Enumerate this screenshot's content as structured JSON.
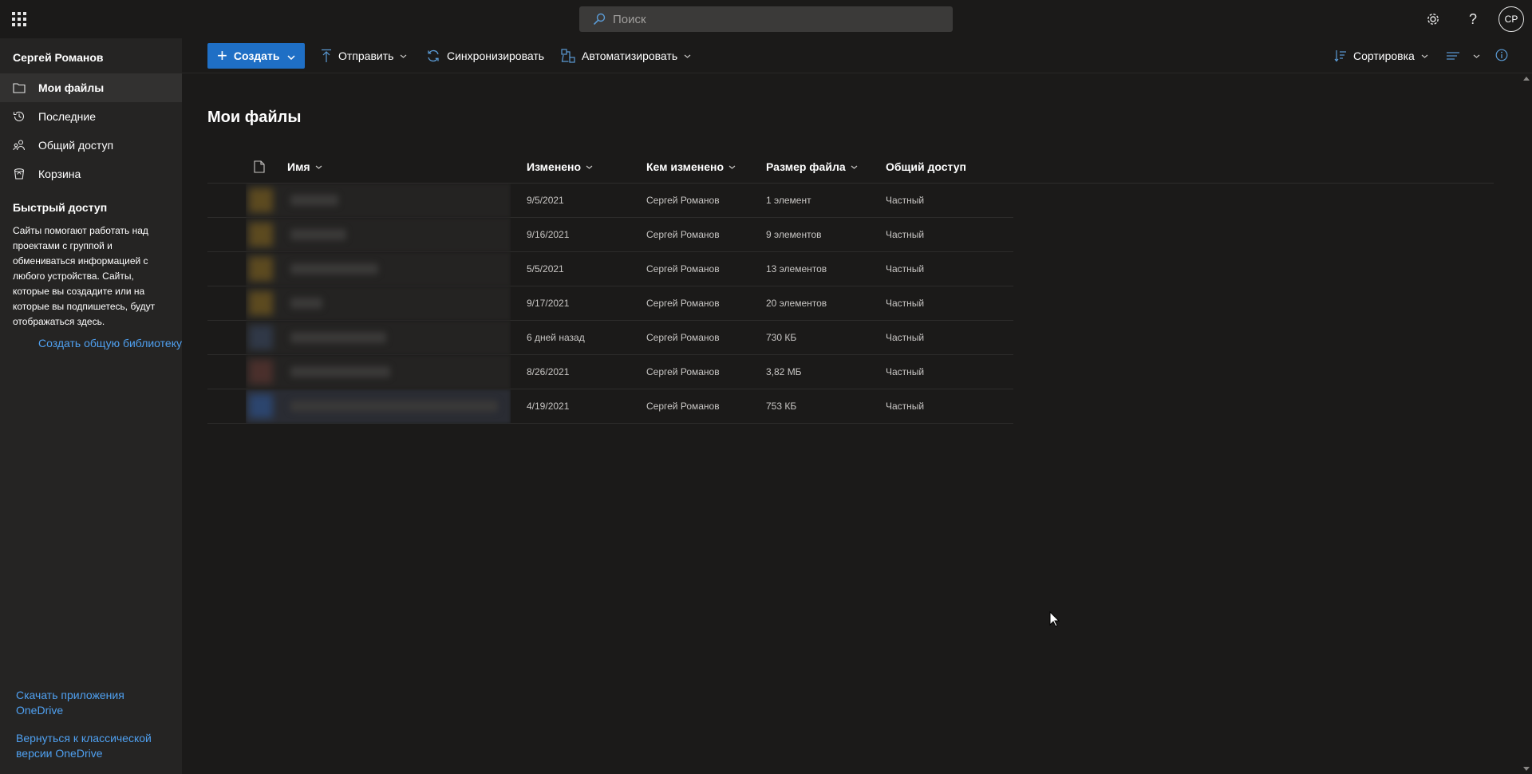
{
  "topbar": {
    "search_placeholder": "Поиск",
    "avatar_initials": "СР"
  },
  "nav": {
    "user_name": "Сергей Романов",
    "items": [
      {
        "label": "Мои файлы",
        "icon": "folder-icon",
        "active": true
      },
      {
        "label": "Последние",
        "icon": "history-icon",
        "active": false
      },
      {
        "label": "Общий доступ",
        "icon": "shared-people-icon",
        "active": false
      },
      {
        "label": "Корзина",
        "icon": "recycle-bin-icon",
        "active": false
      }
    ],
    "quick_access_title": "Быстрый доступ",
    "quick_access_desc": "Сайты помогают работать над проектами с группой и обмениваться информацией с любого устройства. Сайты, которые вы создадите или на которые вы подпишетесь, будут отображаться здесь.",
    "create_library_link": "Создать общую библиотеку",
    "download_apps_link": "Скачать приложения OneDrive",
    "classic_link": "Вернуться к классической версии OneDrive"
  },
  "cmdbar": {
    "create": "Создать",
    "upload": "Отправить",
    "sync": "Синхронизировать",
    "automate": "Автоматизировать",
    "sort": "Сортировка"
  },
  "main": {
    "title": "Мои файлы",
    "columns": {
      "name": "Имя",
      "modified": "Изменено",
      "modified_by": "Кем изменено",
      "size": "Размер файла",
      "sharing": "Общий доступ"
    },
    "rows": [
      {
        "modified": "9/5/2021",
        "modified_by": "Сергей Романов",
        "size": "1 элемент",
        "sharing": "Частный"
      },
      {
        "modified": "9/16/2021",
        "modified_by": "Сергей Романов",
        "size": "9 элементов",
        "sharing": "Частный"
      },
      {
        "modified": "5/5/2021",
        "modified_by": "Сергей Романов",
        "size": "13 элементов",
        "sharing": "Частный"
      },
      {
        "modified": "9/17/2021",
        "modified_by": "Сергей Романов",
        "size": "20 элементов",
        "sharing": "Частный"
      },
      {
        "modified": "6 дней назад",
        "modified_by": "Сергей Романов",
        "size": "730 КБ",
        "sharing": "Частный"
      },
      {
        "modified": "8/26/2021",
        "modified_by": "Сергей Романов",
        "size": "3,82 МБ",
        "sharing": "Частный"
      },
      {
        "modified": "4/19/2021",
        "modified_by": "Сергей Романов",
        "size": "753 КБ",
        "sharing": "Частный"
      }
    ]
  },
  "colors": {
    "background": "#1b1a19",
    "nav_background": "#252423",
    "accent": "#1f6fc5",
    "link": "#4fa0f0",
    "folder_thumb": "#8a6a1e",
    "doc_thumb": "#3a4a66",
    "pdf_thumb": "#6a3a34",
    "word_thumb": "#2e5a9e"
  }
}
